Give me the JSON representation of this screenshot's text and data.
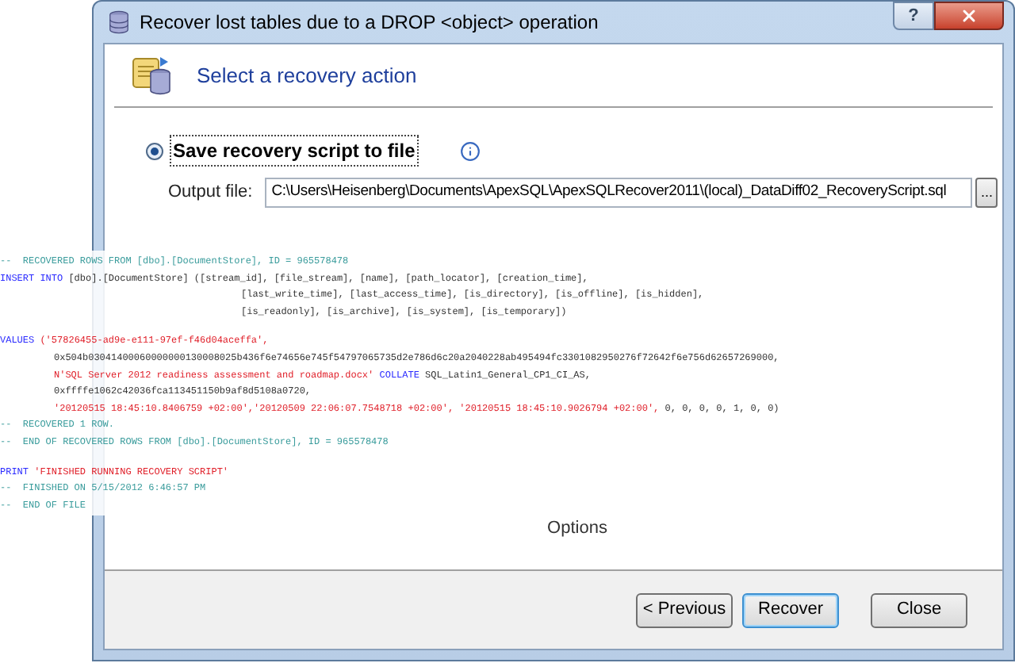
{
  "window": {
    "title": "Recover lost tables due to a DROP <object> operation",
    "help_button": "?"
  },
  "header": {
    "title": "Select a recovery action"
  },
  "recovery_option": {
    "label": "Save recovery script to file",
    "selected": true
  },
  "output_file": {
    "label": "Output file:",
    "value": "C:\\Users\\Heisenberg\\Documents\\ApexSQL\\ApexSQLRecover2011\\(local)_DataDiff02_RecoveryScript.sql",
    "browse_button": "..."
  },
  "script_blocks": [
    [
      {
        "kind": "top",
        "segments": [
          {
            "kind": "comment",
            "text": "--  RECOVERED ROWS FROM [dbo].[DocumentStore], ID = 965578478"
          }
        ]
      },
      {
        "kind": "top",
        "segments": [
          {
            "kind": "keyword",
            "text": "INSERT INTO"
          },
          {
            "kind": "plain",
            "text": " [dbo].[DocumentStore] ([stream_id], [file_stream], [name], [path_locator], [creation_time],"
          }
        ]
      },
      {
        "kind": "columns",
        "segments": [
          {
            "kind": "plain",
            "text": "[last_write_time], [last_access_time], [is_directory], [is_offline], [is_hidden],"
          }
        ]
      },
      {
        "kind": "columns",
        "segments": [
          {
            "kind": "plain",
            "text": "[is_readonly], [is_archive], [is_system], [is_temporary])"
          }
        ]
      }
    ],
    [
      {
        "kind": "top",
        "segments": [
          {
            "kind": "keyword",
            "text": "VALUES"
          },
          {
            "kind": "string",
            "text": " ('57826455-ad9e-e111-97ef-f46d04aceffa',"
          }
        ]
      },
      {
        "kind": "values",
        "segments": [
          {
            "kind": "plain",
            "text": "0x504b03041400060000000130008025b436f6e74656e745f54797065735d2e786d6c20a2040228ab495494fc3301082950276f72642f6e756d62657269000,"
          }
        ]
      },
      {
        "kind": "values",
        "segments": [
          {
            "kind": "string",
            "text": "N'SQL Server 2012 readiness assessment and roadmap.docx'"
          },
          {
            "kind": "keyword",
            "text": " COLLATE"
          },
          {
            "kind": "plain",
            "text": " SQL_Latin1_General_CP1_CI_AS,"
          }
        ]
      },
      {
        "kind": "values",
        "segments": [
          {
            "kind": "plain",
            "text": "0xffffe1062c42036fca113451150b9af8d5108a0720,"
          }
        ]
      },
      {
        "kind": "values",
        "segments": [
          {
            "kind": "string",
            "text": "'20120515 18:45:10.8406759 +02:00','20120509 22:06:07.7548718 +02:00', '20120515 18:45:10.9026794 +02:00',"
          },
          {
            "kind": "plain",
            "text": " 0, 0, 0, 0, 1, 0, 0)"
          }
        ]
      },
      {
        "kind": "top",
        "segments": [
          {
            "kind": "comment",
            "text": "--  RECOVERED 1 ROW."
          }
        ]
      },
      {
        "kind": "top",
        "segments": [
          {
            "kind": "comment",
            "text": "--  END OF RECOVERED ROWS FROM [dbo].[DocumentStore], ID = 965578478"
          }
        ]
      }
    ],
    [
      {
        "kind": "top",
        "segments": [
          {
            "kind": "keyword",
            "text": "PRINT"
          },
          {
            "kind": "string",
            "text": " 'FINISHED RUNNING RECOVERY SCRIPT'"
          }
        ]
      },
      {
        "kind": "top",
        "segments": [
          {
            "kind": "comment",
            "text": "--  FINISHED ON 5/15/2012 6:46:57 PM"
          }
        ]
      },
      {
        "kind": "top",
        "segments": [
          {
            "kind": "comment",
            "text": "--  END OF FILE"
          }
        ]
      }
    ]
  ],
  "options_label": "Options",
  "buttons": [
    {
      "label": "< Previous",
      "default": false
    },
    {
      "label": "Recover",
      "default": true
    },
    {
      "label": "Close",
      "default": false
    }
  ]
}
